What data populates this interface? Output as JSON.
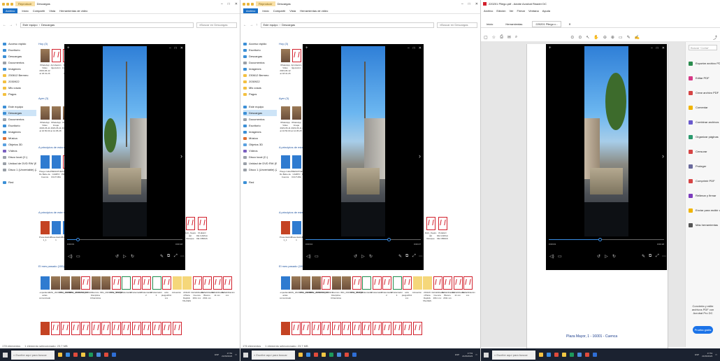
{
  "explorer": {
    "tool_context": "Reproducir",
    "folder_title": "Descargas",
    "ribbon": [
      "Archivo",
      "Inicio",
      "Compartir",
      "Vista",
      "Herramientas de video"
    ],
    "path_root": "Este equipo",
    "path_folder": "Descargas",
    "search_placeholder": "Buscar en Descargas",
    "nav": [
      {
        "label": "Acceso rápido",
        "color": "#3b8fd6",
        "sel": false
      },
      {
        "label": "Escritorio",
        "color": "#3b8fd6",
        "sel": false
      },
      {
        "label": "Descargas",
        "color": "#3b8fd6",
        "sel": false
      },
      {
        "label": "Documentos",
        "color": "#9aa0a8",
        "sel": false
      },
      {
        "label": "Imágenes",
        "color": "#3b8fd6",
        "sel": false
      },
      {
        "label": "230612 Bermeo",
        "color": "#f3c040",
        "sel": false
      },
      {
        "label": "2030922",
        "color": "#f3c040",
        "sel": false
      },
      {
        "label": "Mis cosas",
        "color": "#f3c040",
        "sel": false
      },
      {
        "label": "Pagos",
        "color": "#f3c040",
        "sel": false
      },
      {
        "label": "",
        "color": "#ffffff",
        "sel": false
      },
      {
        "label": "Este equipo",
        "color": "#3b8fd6",
        "sel": false
      },
      {
        "label": "Descargas",
        "color": "#3b8fd6",
        "sel": true
      },
      {
        "label": "Documentos",
        "color": "#9aa0a8",
        "sel": false
      },
      {
        "label": "Escritorio",
        "color": "#3b8fd6",
        "sel": false
      },
      {
        "label": "Imágenes",
        "color": "#3b8fd6",
        "sel": false
      },
      {
        "label": "Música",
        "color": "#e07030",
        "sel": false
      },
      {
        "label": "Objetos 3D",
        "color": "#5aa0e0",
        "sel": false
      },
      {
        "label": "Vídeos",
        "color": "#7a5fc0",
        "sel": false
      },
      {
        "label": "Disco local (C:)",
        "color": "#9aa0a8",
        "sel": false
      },
      {
        "label": "Unidad de DVD RW (E:) Ayuntamiento",
        "color": "#9aa0a8",
        "sel": false
      },
      {
        "label": "Disco 1 (Unvertable) (Z:)",
        "color": "#9aa0a8",
        "sel": false
      },
      {
        "label": "",
        "color": "#ffffff",
        "sel": false
      },
      {
        "label": "Red",
        "color": "#3b8fd6",
        "sel": false
      }
    ],
    "groups": [
      "Hoy (3)",
      "Ayer (3)",
      "A principios de esta semana (3)",
      "A principios de este mes (18)",
      "El mes pasado (155)"
    ],
    "row1": [
      {
        "type": "tile-img",
        "cap": "WhatsApp Video 2023-06-12 at 18.31.26"
      },
      {
        "type": "pdf",
        "cap": "Aprobación Ejecución"
      },
      {
        "type": "pdf",
        "cap": "Solicitud inscripción Ayto Cuenca"
      }
    ],
    "row2": [
      {
        "type": "img",
        "cap": "WhatsApp Video 2023-06-11 at 16.50.00"
      },
      {
        "type": "img",
        "cap": "WhatsApp Image 2023-06-11 at 12.05.28"
      },
      {
        "type": "img",
        "cap": "WhatsApp Image 2023-06-11"
      }
    ],
    "row3": [
      {
        "type": "blue",
        "cap": "Pliego Cafe Ru Bebe de Cuenca"
      },
      {
        "type": "blue",
        "cap": "PRESUPUESTO CAMPO CULTURA"
      },
      {
        "type": "pdf",
        "cap": "2305 PRESUPUESTO"
      }
    ],
    "row4": [
      {
        "type": "ppt",
        "cap": "Presentación 1_1"
      },
      {
        "type": "blue",
        "cap": "Presentación 1"
      },
      {
        "type": "blue",
        "cap": "Presentación 1_1"
      }
    ],
    "row4_right": [
      {
        "type": "pdf",
        "cap": "DAC_Teatro del Retoque"
      },
      {
        "type": "pdf",
        "cap": "PLIEGO DE CARGA DE OBRAS"
      }
    ],
    "row5": [
      {
        "type": "blue",
        "cap": "expediente actas comunicado"
      },
      {
        "type": "img",
        "cap": "IMG_20230712_150657"
      },
      {
        "type": "img",
        "cap": "IMG_20230712_155846"
      },
      {
        "type": "img",
        "cap": "IMG_20230710_160421"
      },
      {
        "type": "pdf",
        "cap": "DDDD"
      },
      {
        "type": "img",
        "cap": "Decreto Disciplina Urbanística"
      },
      {
        "type": "img",
        "cap": "IMG_20230712_150657"
      },
      {
        "type": "pdf",
        "cap": "IMG_5847_1"
      },
      {
        "type": "xls",
        "cap": "FCalentador"
      },
      {
        "type": "pdf",
        "cap": "FCalentador"
      },
      {
        "type": "pdf",
        "cap": "FCalentador 2"
      },
      {
        "type": "xls",
        "cap": "FCalentador 3"
      },
      {
        "type": "pdf",
        "cap": "acta pleigo2011 xxx"
      },
      {
        "type": "yellow",
        "cap": "Actuación"
      },
      {
        "type": "yellow",
        "cap": "231126 nPlaza Daptick TALKIES"
      },
      {
        "type": "pdf",
        "cap": "Rehabilitación Cuenca 2011 xxx"
      },
      {
        "type": "pdf",
        "cap": "Rehabilitación Blanco 2011 xxx"
      },
      {
        "type": "pdf",
        "cap": "Rehabilitación 11 xxx"
      },
      {
        "type": "pdf",
        "cap": "Rehabilitación xxx"
      }
    ],
    "row6_count": 14,
    "status": [
      "178 elementos",
      "1 elemento seleccionado: 23,7 MB"
    ],
    "status2": [
      "176 elementos",
      "1 elemento seleccionado: 23,7 MB"
    ]
  },
  "video": {
    "time_left": "0:00:03",
    "time_right": "0:00:18",
    "time_left_b": "0:00:04",
    "time_right_b": "0:00:27",
    "progress": 0.09,
    "progress_b": 0.72,
    "progress_c": 0.44
  },
  "pdf": {
    "title": "220201 Pliego.pdf - Adobe Acrobat Reader DC",
    "menu": [
      "Archivo",
      "Edición",
      "Ver",
      "Firmar",
      "Ventana",
      "Ayuda"
    ],
    "tabs": [
      "Inicio",
      "Herramientas",
      "220201 Pliego c..."
    ],
    "footer_address": "Plaza Mayor, 1 - 16001 - Cuenca",
    "search_placeholder": "Buscar 'Cortar'",
    "tools": [
      {
        "label": "Exportar archivo PDF",
        "color": "#2b8c4e"
      },
      {
        "label": "Editar PDF",
        "color": "#d53a86"
      },
      {
        "label": "Crear archivo PDF",
        "color": "#d64545"
      },
      {
        "label": "Comentar",
        "color": "#f0b400"
      },
      {
        "label": "Combinar archivos",
        "color": "#6a5acd"
      },
      {
        "label": "Organizar páginas",
        "color": "#2b9a6e"
      },
      {
        "label": "Censurar",
        "color": "#d64545"
      },
      {
        "label": "Proteger",
        "color": "#6a6a9c"
      },
      {
        "label": "Comprimir PDF",
        "color": "#d64545"
      },
      {
        "label": "Rellenar y firmar",
        "color": "#7d3cbd"
      },
      {
        "label": "Enviar para recibir comentarios",
        "color": "#f0b400"
      },
      {
        "label": "Más herramientas",
        "color": "#555555"
      }
    ],
    "promo_note": "Convierta y edite archivos PDF con Acrobat Pro DC",
    "promo_button": "Prueba gratis"
  },
  "taskbar": {
    "search_placeholder": "Escribe aquí para buscar",
    "time_a": "17:53",
    "date_a": "21/06/2023",
    "time_b": "17:53",
    "date_b": "21/06/2023",
    "time_c": "17:53",
    "date_c": "21/06/2023",
    "lang": "ESP",
    "apps": [
      "#f6c343",
      "#3a8ee6",
      "#e04b3b",
      "#f2c744",
      "#1d9a5c",
      "#4a8bdc",
      "#e04b3b",
      "#2f6fd6"
    ]
  }
}
